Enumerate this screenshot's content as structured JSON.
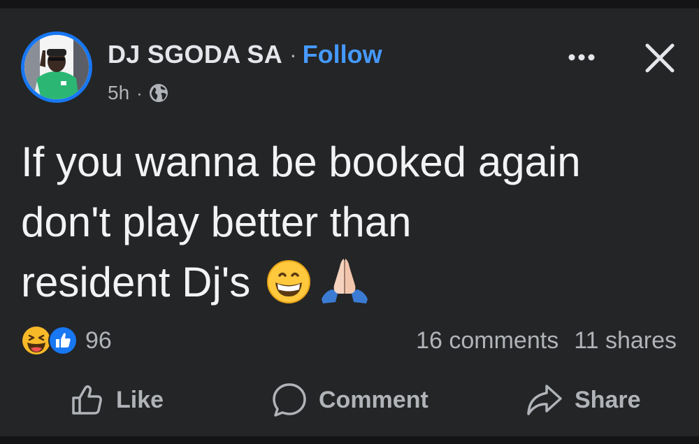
{
  "post": {
    "author": "DJ SGODA SA",
    "separator": "·",
    "follow_label": "Follow",
    "time": "5h",
    "meta_separator": "·",
    "privacy_icon": "globe-icon",
    "text_line_1": "If you wanna be booked again",
    "text_line_2": "don't play better than",
    "text_line_3": "resident Dj's",
    "text_emojis": [
      "grinning-face-emoji",
      "folded-hands-emoji"
    ]
  },
  "header_controls": {
    "more_icon": "more-options-icon",
    "close_icon": "close-icon"
  },
  "reactions": {
    "icons": [
      "haha-reaction-icon",
      "like-reaction-icon"
    ],
    "count": "96"
  },
  "stats": {
    "comments": "16 comments",
    "shares": "11 shares"
  },
  "actions": {
    "like": "Like",
    "comment": "Comment",
    "share": "Share"
  },
  "colors": {
    "background": "#242526",
    "text": "#e4e6eb",
    "muted": "#b0b3b8",
    "link": "#4599ff",
    "avatar_ring": "#1877f2"
  }
}
